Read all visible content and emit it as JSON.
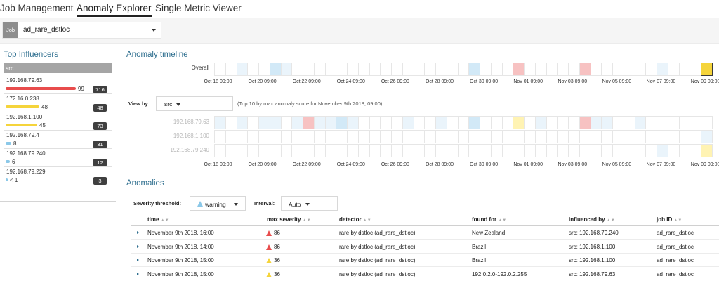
{
  "tabs": [
    {
      "label": "Job Management",
      "active": false
    },
    {
      "label": "Anomaly Explorer",
      "active": true
    },
    {
      "label": "Single Metric Viewer",
      "active": false
    }
  ],
  "job_selector": {
    "badge": "Job",
    "value": "ad_rare_dstloc"
  },
  "influencers": {
    "title": "Top Influencers",
    "field": "src",
    "items": [
      {
        "name": "192.168.79.63",
        "score": "99",
        "fraction": 0.99,
        "total": "716",
        "color": "#e84c4c"
      },
      {
        "name": "172.16.0.238",
        "score": "48",
        "fraction": 0.48,
        "total": "48",
        "color": "#f5d43b"
      },
      {
        "name": "192.168.1.100",
        "score": "45",
        "fraction": 0.45,
        "total": "73",
        "color": "#f5d43b"
      },
      {
        "name": "192.168.79.4",
        "score": "8",
        "fraction": 0.08,
        "total": "31",
        "color": "#8bc8e8"
      },
      {
        "name": "192.168.79.240",
        "score": "6",
        "fraction": 0.06,
        "total": "12",
        "color": "#8bc8e8"
      },
      {
        "name": "192.168.79.229",
        "score": "< 1",
        "fraction": 0.01,
        "total": "3",
        "color": "#8bc8e8"
      }
    ]
  },
  "timeline": {
    "title": "Anomaly timeline",
    "overall_label": "Overall",
    "ticks": [
      "Oct 18 09:00",
      "Oct 20 09:00",
      "Oct 22 09:00",
      "Oct 24 09:00",
      "Oct 26 09:00",
      "Oct 28 09:00",
      "Oct 30 09:00",
      "Nov 01 09:00",
      "Nov 03 09:00",
      "Nov 05 09:00",
      "Nov 07 09:00",
      "Nov 09 09:00"
    ],
    "colors": {
      "none": "#ffffff",
      "low": "#eaf4fb",
      "minor": "#d2e9f7",
      "warn": "#fff3b3",
      "warn_strong": "#f5d43b",
      "crit": "#f7c2c2"
    },
    "overall_cells": [
      "none",
      "none",
      "low",
      "none",
      "none",
      "minor",
      "low",
      "none",
      "none",
      "none",
      "none",
      "none",
      "none",
      "none",
      "none",
      "none",
      "none",
      "none",
      "none",
      "none",
      "none",
      "none",
      "none",
      "minor",
      "none",
      "none",
      "none",
      "crit",
      "none",
      "none",
      "none",
      "none",
      "none",
      "crit",
      "none",
      "none",
      "none",
      "none",
      "none",
      "none",
      "low",
      "none",
      "none",
      "none",
      "warn_strong"
    ],
    "view_by": {
      "label": "View by:",
      "value": "src",
      "note": "(Top 10 by max anomaly score for November 9th 2018, 09:00)",
      "lanes": [
        {
          "label": "192.168.79.63",
          "cells": [
            "low",
            "none",
            "low",
            "none",
            "low",
            "low",
            "none",
            "low",
            "crit",
            "low",
            "low",
            "minor",
            "low",
            "none",
            "none",
            "none",
            "none",
            "low",
            "none",
            "none",
            "low",
            "none",
            "none",
            "minor",
            "none",
            "none",
            "none",
            "warn",
            "none",
            "low",
            "none",
            "none",
            "none",
            "crit",
            "low",
            "low",
            "none",
            "none",
            "low",
            "none",
            "none",
            "none",
            "none",
            "none",
            "none"
          ]
        },
        {
          "label": "192.168.1.100",
          "cells": [
            "none",
            "none",
            "none",
            "none",
            "none",
            "none",
            "none",
            "none",
            "none",
            "none",
            "none",
            "none",
            "none",
            "none",
            "none",
            "none",
            "none",
            "none",
            "none",
            "none",
            "none",
            "none",
            "none",
            "none",
            "none",
            "none",
            "none",
            "none",
            "none",
            "none",
            "none",
            "none",
            "none",
            "none",
            "none",
            "none",
            "none",
            "none",
            "none",
            "none",
            "none",
            "none",
            "none",
            "none",
            "low"
          ]
        },
        {
          "label": "192.168.79.240",
          "cells": [
            "none",
            "none",
            "none",
            "none",
            "none",
            "none",
            "none",
            "none",
            "none",
            "none",
            "none",
            "none",
            "none",
            "none",
            "none",
            "none",
            "none",
            "none",
            "none",
            "none",
            "none",
            "none",
            "none",
            "none",
            "none",
            "none",
            "none",
            "none",
            "none",
            "none",
            "none",
            "none",
            "none",
            "none",
            "none",
            "none",
            "none",
            "none",
            "none",
            "none",
            "low",
            "none",
            "none",
            "none",
            "warn"
          ]
        }
      ]
    }
  },
  "anomalies": {
    "title": "Anomalies",
    "severity_label": "Severity threshold:",
    "severity_value": "warning",
    "interval_label": "Interval:",
    "interval_value": "Auto",
    "columns": [
      "time",
      "max severity",
      "detector",
      "found for",
      "influenced by",
      "job ID"
    ],
    "rows": [
      {
        "time": "November 9th 2018, 16:00",
        "severity": "86",
        "severity_color": "#e84c4c",
        "detector": "rare by dstloc (ad_rare_dstloc)",
        "found_for": "New Zealand",
        "influenced_by": "src: 192.168.79.240",
        "job_id": "ad_rare_dstloc"
      },
      {
        "time": "November 9th 2018, 14:00",
        "severity": "86",
        "severity_color": "#e84c4c",
        "detector": "rare by dstloc (ad_rare_dstloc)",
        "found_for": "Brazil",
        "influenced_by": "src: 192.168.1.100",
        "job_id": "ad_rare_dstloc"
      },
      {
        "time": "November 9th 2018, 15:00",
        "severity": "36",
        "severity_color": "#f5d43b",
        "detector": "rare by dstloc (ad_rare_dstloc)",
        "found_for": "Brazil",
        "influenced_by": "src: 192.168.1.100",
        "job_id": "ad_rare_dstloc"
      },
      {
        "time": "November 9th 2018, 15:00",
        "severity": "36",
        "severity_color": "#f5d43b",
        "detector": "rare by dstloc (ad_rare_dstloc)",
        "found_for": "192.0.2.0-192.0.2.255",
        "influenced_by": "src: 192.168.79.63",
        "job_id": "ad_rare_dstloc"
      }
    ]
  }
}
